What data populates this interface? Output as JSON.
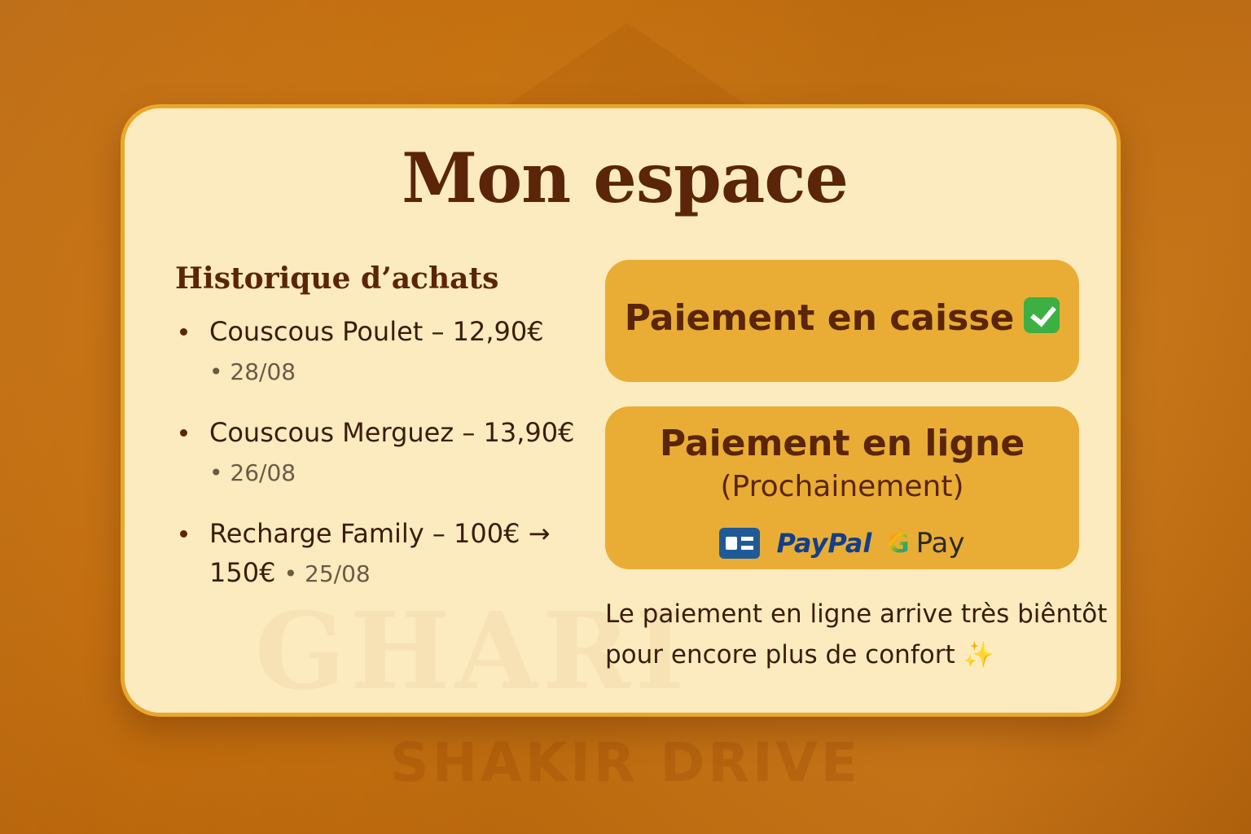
{
  "background": {
    "brand": "SHAKIR DRIVE"
  },
  "card": {
    "title": "Mon espace",
    "watermark": "GHARI"
  },
  "history": {
    "heading": "Historique d’achats",
    "items": [
      {
        "text": "Couscous Poulet – 12,90€",
        "date": "• 28/08"
      },
      {
        "text": "Couscous Merguez – 13,90€",
        "date": "• 26/08"
      },
      {
        "text": "Recharge Family – 100€ → 150€",
        "date": "• 25/08"
      }
    ]
  },
  "payment_cash": {
    "label": "Paiement en caisse",
    "icon": "check-mark-icon",
    "icon_color": "#3cb043"
  },
  "payment_online": {
    "label": "Paiement en ligne",
    "sub": "(Prochainement)",
    "methods": {
      "card_icon": "credit-card-icon",
      "paypal": "PayPal",
      "gpay_letter": "G",
      "gpay": "Pay"
    }
  },
  "note": {
    "text": "Le paiement en ligne arrive très biêntôt pour encore plus de confort",
    "icon": "sparkles-icon"
  },
  "colors": {
    "background": "#c9720f",
    "card": "#fdebc0",
    "card_border": "#e9a82c",
    "button": "#e9ad35",
    "text_dark": "#5a2508"
  }
}
